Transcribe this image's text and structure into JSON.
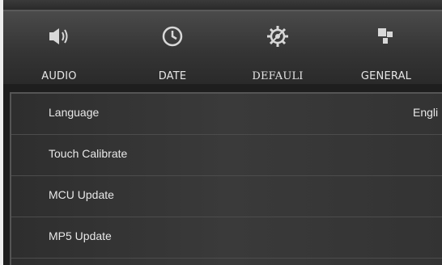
{
  "tabs": [
    {
      "label": "AUDIO",
      "icon": "speaker-icon"
    },
    {
      "label": "DATE",
      "icon": "clock-icon"
    },
    {
      "label": "DEFAULI",
      "icon": "gear-icon"
    },
    {
      "label": "GENERAL",
      "icon": "blocks-icon"
    }
  ],
  "settings": [
    {
      "label": "Language",
      "value": "Engli"
    },
    {
      "label": "Touch Calibrate"
    },
    {
      "label": "MCU  Update"
    },
    {
      "label": "MP5  Update"
    }
  ]
}
